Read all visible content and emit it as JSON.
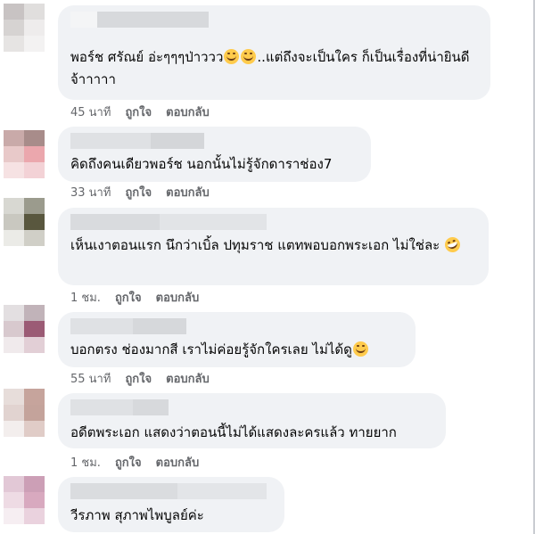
{
  "comments": [
    {
      "text_parts": [
        "พอร์ช ศรัณย์ อ่ะๆๆๆป่าววว",
        "",
        "..แต่ถึงจะเป็นใคร ก็เป็นเรื่องที่น่ายินดีจ้าาาาา"
      ],
      "time": "45 นาที",
      "like": "ถูกใจ",
      "reply": "ตอบกลับ",
      "emoji": [
        "grin-emoji",
        "grin-emoji"
      ]
    },
    {
      "text": "คิดถึงคนเดียวพอร์ช นอกนั้นไม่รู้จักดาราช่อง7",
      "time": "33 นาที",
      "like": "ถูกใจ",
      "reply": "ตอบกลับ"
    },
    {
      "text": "เห็นเงาตอนแรก นึกว่าเบิ้ล ปทุมราช แตทพอบอกพระเอก ไม่ใช่ละ",
      "time": "1 ชม.",
      "like": "ถูกใจ",
      "reply": "ตอบกลับ",
      "emoji": [
        "rofl-emoji"
      ]
    },
    {
      "text": "บอกตรง ช่องมากสี เราไม่ค่อยรู้จักใครเลย ไม่ได้ดู",
      "time": "55 นาที",
      "like": "ถูกใจ",
      "reply": "ตอบกลับ",
      "emoji": [
        "sweat-smile-emoji"
      ]
    },
    {
      "text": "อดีตพระเอก แสดงว่าตอนนี้ไม่ได้แสดงละครแล้ว ทายยาก",
      "time": "1 ชม.",
      "like": "ถูกใจ",
      "reply": "ตอบกลับ"
    },
    {
      "text": "วีรภาพ สุภาพไพบูลย์ค่ะ"
    }
  ],
  "colors": {
    "bubble": "#f0f2f5",
    "meta_text": "#65676b",
    "body_text": "#050505"
  }
}
